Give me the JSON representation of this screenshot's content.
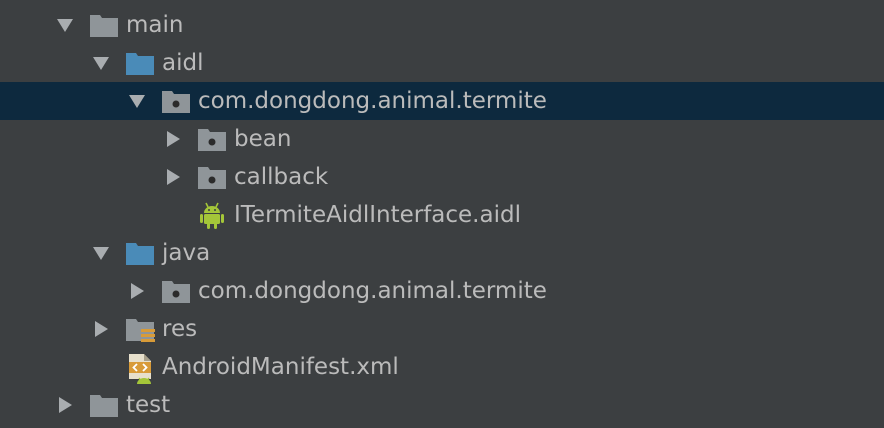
{
  "tree": {
    "main": {
      "label": "main",
      "expanded": true,
      "icon": "folder-icon"
    },
    "aidl": {
      "label": "aidl",
      "expanded": true,
      "icon": "source-folder-icon"
    },
    "aidl_package": {
      "label": "com.dongdong.animal.termite",
      "expanded": true,
      "selected": true,
      "icon": "package-icon"
    },
    "bean": {
      "label": "bean",
      "expanded": false,
      "icon": "package-icon"
    },
    "callback": {
      "label": "callback",
      "expanded": false,
      "icon": "package-icon"
    },
    "aidl_file": {
      "label": "ITermiteAidlInterface.aidl",
      "icon": "android-icon"
    },
    "java": {
      "label": "java",
      "expanded": true,
      "icon": "source-folder-icon"
    },
    "java_package": {
      "label": "com.dongdong.animal.termite",
      "expanded": false,
      "icon": "package-icon"
    },
    "res": {
      "label": "res",
      "expanded": false,
      "icon": "resource-folder-icon"
    },
    "manifest": {
      "label": "AndroidManifest.xml",
      "icon": "manifest-file-icon"
    },
    "test": {
      "label": "test",
      "expanded": false,
      "icon": "folder-icon"
    }
  },
  "colors": {
    "background": "#3c3f41",
    "selection": "#0d293e",
    "text": "#bbbbbb",
    "arrow": "#a9adb0",
    "folder": "#8f9599",
    "source_folder": "#4a8bb8",
    "android_green": "#a4c639",
    "manifest_orange": "#d89b38"
  }
}
